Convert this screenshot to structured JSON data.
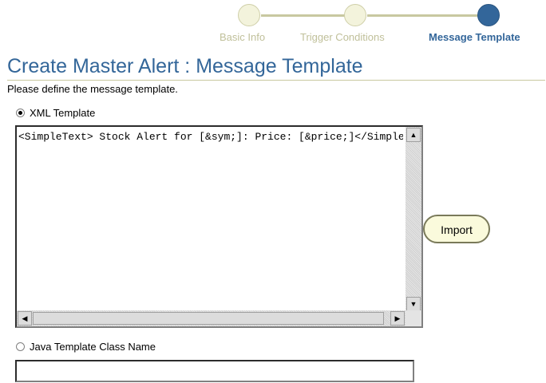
{
  "train": {
    "steps": [
      {
        "label": "Basic Info",
        "state": "visited"
      },
      {
        "label": "Trigger Conditions",
        "state": "visited"
      },
      {
        "label": "Message Template",
        "state": "current"
      }
    ]
  },
  "page": {
    "title": "Create Master Alert : Message Template",
    "instruction": "Please define the message template."
  },
  "template": {
    "xml_option_label": "XML Template",
    "xml_selected": true,
    "xml_value": "<SimpleText> Stock Alert for [&sym;]: Price: [&price;]</SimpleText>",
    "import_label": "Import",
    "java_option_label": "Java Template Class Name",
    "java_value": ""
  },
  "colors": {
    "accent": "#336699",
    "step_visited": "#c0c09a",
    "step_current": "#33669a",
    "rule": "#c8c8a0"
  }
}
